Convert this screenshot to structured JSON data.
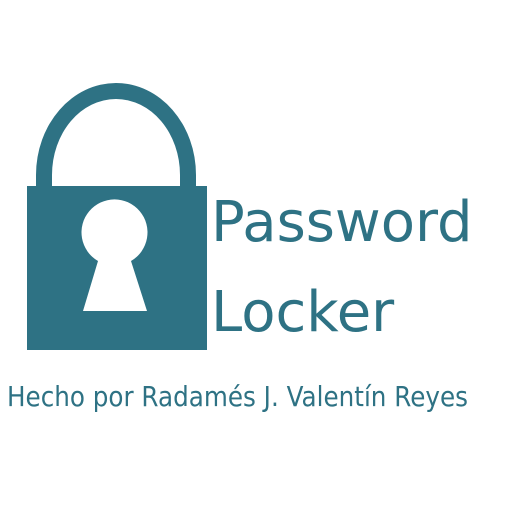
{
  "logo": {
    "icon": "padlock-icon",
    "brand_color": "#2e7284",
    "title_line_1": "Password",
    "title_line_2": "Locker"
  },
  "credit": "Hecho por Radamés J. Valentín Reyes"
}
